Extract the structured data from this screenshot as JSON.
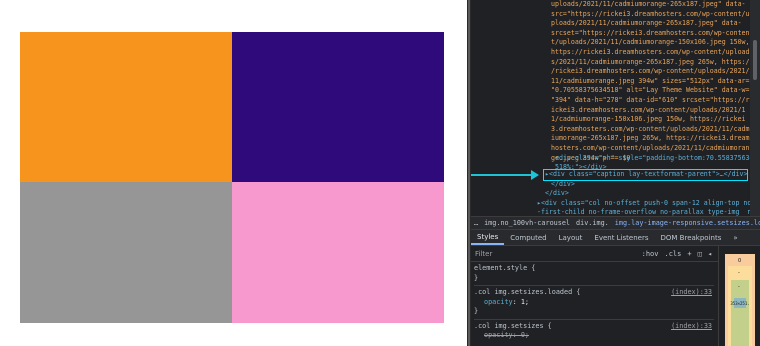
{
  "viewport": {
    "swatches": [
      {
        "name": "orange",
        "color": "#f7941d"
      },
      {
        "name": "indigo",
        "color": "#2e0a7a"
      },
      {
        "name": "gray",
        "color": "#969696"
      },
      {
        "name": "pink",
        "color": "#f799cf"
      }
    ]
  },
  "elements": {
    "code_lines": [
      "uploads/2021/11/cadmiumorange-265x187.jpeg\" data-",
      "src=\"https://rickei3.dreamhosters.com/wp-content/u",
      "ploads/2021/11/cadmiumorange-265x187.jpeg\" data-",
      "srcset=\"https://rickei3.dreamhosters.com/wp-conten",
      "t/uploads/2021/11/cadmiumorange-150x106.jpeg 150w,",
      "https://rickei3.dreamhosters.com/wp-content/upload",
      "s/2021/11/cadmiumorange-265x187.jpeg 265w, https:/",
      "/rickei3.dreamhosters.com/wp-content/uploads/2021/",
      "11/cadmiumorange.jpeg 394w\" sizes=\"512px\" data-ar=",
      "\"0.70558375634518\" alt=\"Lay Theme Website\" data-w=",
      "\"394\" data-h=\"278\" data-id=\"610\" srcset=\"https://r",
      "ickei3.dreamhosters.com/wp-content/uploads/2021/1",
      "1/cadmiumorange-150x106.jpeg 150w, https://rickei",
      "3.dreamhosters.com/wp-content/uploads/2021/11/cadm",
      "iumorange-265x187.jpeg 265w, https://rickei3.dream",
      "hosters.com/wp-content/uploads/2021/11/cadmiumoran",
      "ge.jpeg 394w\"> == $0"
    ],
    "ph_line1": "<div class=\"ph\" style=\"padding-bottom:70.558375634",
    "ph_line2": "518%;\"></div>",
    "caption_line": "▸<div class=\"caption lay-textformat-parent\">…</div>",
    "close_div1": "</div>",
    "close_div2": "</div>",
    "col_line1": "▸<div class=\"col no-offset push-0 span-12 align-top not",
    "col_line2": "-first-child no-frame-overflow no-parallax type-img  no_"
  },
  "breadcrumb": [
    "…",
    "img.no_100vh-carousel",
    "div.img.",
    "img.lay-image-responsive.setsizes.loaded"
  ],
  "tabs": [
    "Styles",
    "Computed",
    "Layout",
    "Event Listeners",
    "DOM Breakpoints",
    "»"
  ],
  "styles": {
    "filter_placeholder": "Filter",
    "hov": ":hov",
    "cls": ".cls",
    "plus": "+",
    "rule1_selector": "element.style {",
    "rule1_close": "}",
    "rule2_selector": ".col img.setsizes.loaded {",
    "rule2_source": "(index):33",
    "rule2_prop": "opacity",
    "rule2_val": "1;",
    "rule2_close": "}",
    "rule3_selector": ".col img.setsizes {",
    "rule3_source": "(index):33",
    "rule3_prop_val": "opacity: 0;"
  },
  "boxmodel": {
    "margin": "0",
    "border": "-",
    "padding": "-",
    "content": "353×251."
  }
}
